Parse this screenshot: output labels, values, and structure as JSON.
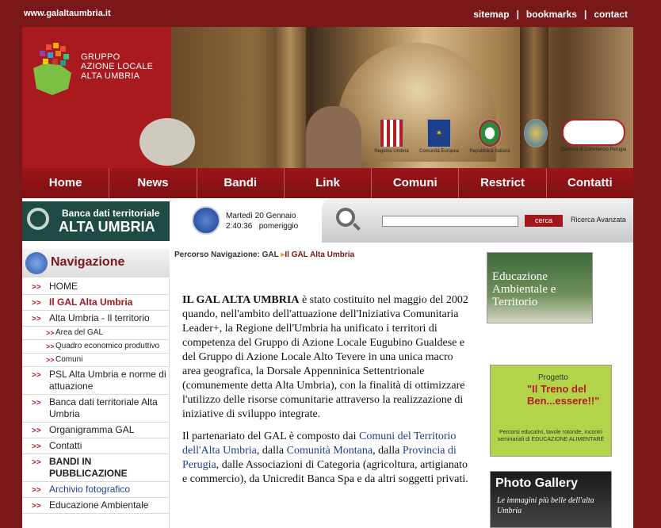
{
  "top": {
    "url": "www.galaltaumbria.it",
    "links": [
      "sitemap",
      "bookmarks",
      "contact"
    ]
  },
  "logo": {
    "line1": "GRUPPO",
    "line2": "AZIONE LOCALE",
    "line3": "ALTA UMBRIA"
  },
  "sponsors": [
    "Regione Umbria",
    "Comunità Europea",
    "Repubblica Italiana",
    "",
    "Camera di Commercio Perugia"
  ],
  "nav": [
    "Home",
    "News",
    "Bandi",
    "Link",
    "Comuni",
    "Restrict",
    "Contatti"
  ],
  "banca": {
    "line1": "Banca dati territoriale",
    "line2": "ALTA UMBRIA"
  },
  "clock": {
    "date": "Martedì 20 Gennaio",
    "time": "2:40:36",
    "period": "pomeriggio"
  },
  "search": {
    "button": "cerca",
    "advanced": "Ricerca Avanzata"
  },
  "sidebar": {
    "title": "Navigazione",
    "items": [
      "HOME",
      "Il GAL Alta Umbria",
      "Alta Umbria - Il territorio",
      "Area del GAL",
      "Quadro economico produttivo",
      "Comuni",
      "PSL Alta Umbria e norme di attuazione",
      "Banca dati territoriale Alta Umbria",
      "Organigramma GAL",
      "Contatti",
      "BANDI IN PUBBLICAZIONE",
      "Archivio fotografico",
      "Educazione Ambientale"
    ]
  },
  "breadcrumb": {
    "label": "Percorso Navigazione:",
    "root": "GAL",
    "current": "Il GAL Alta Umbria"
  },
  "article": {
    "lead": "IL GAL ALTA UMBRIA",
    "p1": " è stato costituito nel maggio del 2002 quando, nell'ambito dell'attuazione dell'Iniziativa Comunitaria Leader+, la Regione dell'Umbria ha unificato i territori di competenza del Gruppo di Azione Locale Eugubino Gualdese e del Gruppo di Azione Locale Alto Tevere in una unica macro area geografica, la Dorsale Appenninica Settentrionale (comunemente detta Alta Umbria), con la finalità di ottimizzare l'utilizzo delle risorse comunitarie attraverso la realizzazione di iniziative di sviluppo integrate.",
    "p2a": "Il partenariato del GAL è composto dai ",
    "link1": "Comuni del Territorio dell'Alta Umbria",
    "p2b": ", dalla ",
    "link2": "Comunità Montana",
    "p2c": ", dalla ",
    "link3": "Provincia di Perugia",
    "p2d": ", dalle Associazioni di Categoria (agricoltura, artigianato e commercio), da Unicredit Banca Spa e da altri soggetti privati."
  },
  "right": {
    "edu": "Educazione Ambientale e Territorio",
    "treno": {
      "pre": "Progetto",
      "title": "\"Il Treno del Ben...essere!!\"",
      "desc": "Percorsi educativi, tavole rotonde, incontri seminariali di EDUCAZIONE ALIMENTARE"
    },
    "gallery": {
      "title": "Photo Gallery",
      "sub": "Le immagini più belle dell'alta Umbria"
    }
  }
}
